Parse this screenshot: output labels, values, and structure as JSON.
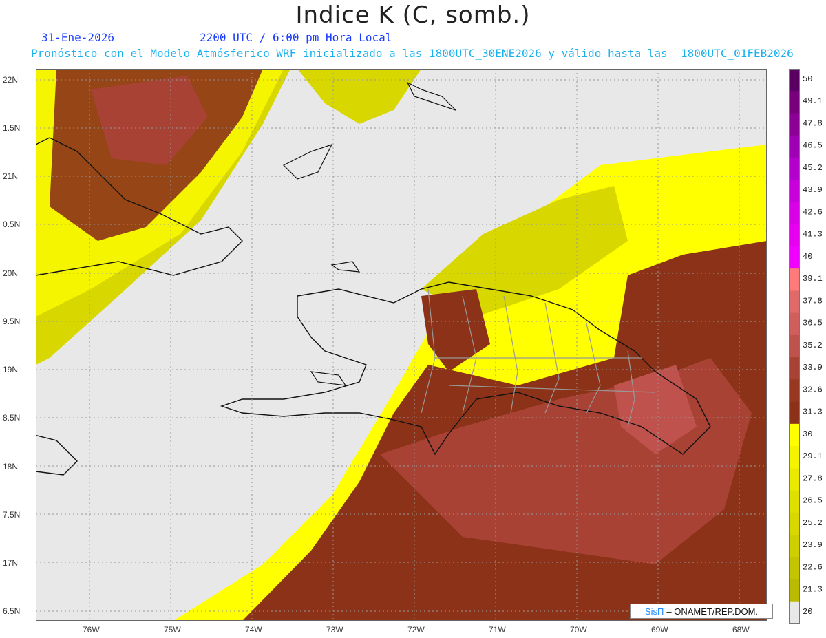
{
  "title": "Indice K (C, somb.)",
  "date_line": "31-Ene-2026",
  "time_line": "2200 UTC / 6:00 pm Hora Local",
  "forecast_line": "Pronóstico con el Modelo Atmósferico WRF inicializado a las 1800UTC_30ENE2026 y válido hasta las  1800UTC_01FEB2026",
  "accent_color": "#1a3cff",
  "subtitle_color": "#19b0f0",
  "map": {
    "lat_labels": [
      "22N",
      "1.5N",
      "21N",
      "0.5N",
      "20N",
      "9.5N",
      "19N",
      "8.5N",
      "18N",
      "7.5N",
      "17N",
      "6.5N"
    ],
    "lon_labels": [
      "76W",
      "75W",
      "74W",
      "73W",
      "72W",
      "71W",
      "70W",
      "69W",
      "68W"
    ]
  },
  "colorbar": {
    "labels": [
      "50",
      "49.1",
      "47.8",
      "46.5",
      "45.2",
      "43.9",
      "42.6",
      "41.3",
      "40",
      "39.1",
      "37.8",
      "36.5",
      "35.2",
      "33.9",
      "32.6",
      "31.3",
      "30",
      "29.1",
      "27.8",
      "26.5",
      "25.2",
      "23.9",
      "22.6",
      "21.3",
      "20"
    ],
    "colors": [
      "#5a0062",
      "#78007d",
      "#8c0096",
      "#a000b4",
      "#b400cc",
      "#c800dc",
      "#d700e6",
      "#e600ef",
      "#f000ff",
      "#ff7a7a",
      "#e06a6a",
      "#d05e5c",
      "#c0524e",
      "#a84234",
      "#983820",
      "#8b3218",
      "#ffff00",
      "#f4f400",
      "#eaea00",
      "#e0e000",
      "#d8d800",
      "#cece00",
      "#c4c400",
      "#baba00",
      "#e8e8e8"
    ]
  },
  "credit": {
    "brand": "SisΠ",
    "text": "–  ONAMET/REP.DOM."
  }
}
